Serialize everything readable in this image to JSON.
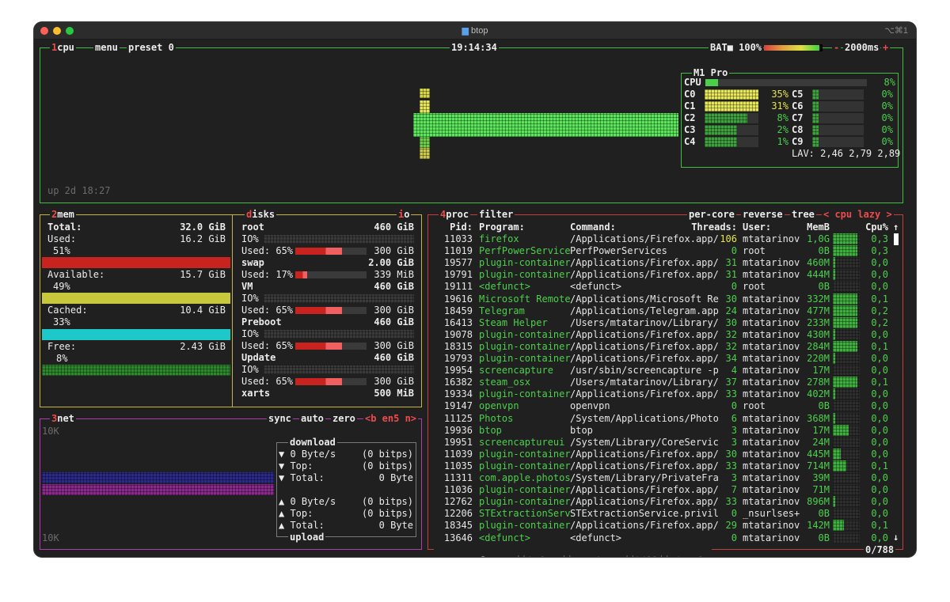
{
  "window": {
    "title": "btop",
    "shortcut": "⌥⌘1"
  },
  "cpu": {
    "label_num": "1",
    "label": "cpu",
    "menu_label": "menu",
    "preset_label": "preset 0",
    "clock": "19:14:34",
    "battery": "BAT■ 100%",
    "battery_percent": 100,
    "interval": "2000ms",
    "minus": "-",
    "plus": "+",
    "uptime": "up 2d 18:27",
    "model": "M1 Pro",
    "total_label": "CPU",
    "total_pct": "8%",
    "total_frac": 0.08,
    "cores": [
      {
        "name": "C0",
        "pct": "35%",
        "frac": 0.35,
        "hot": true
      },
      {
        "name": "C1",
        "pct": "31%",
        "frac": 0.31,
        "hot": true
      },
      {
        "name": "C2",
        "pct": "8%",
        "frac": 0.08,
        "hot": false
      },
      {
        "name": "C3",
        "pct": "2%",
        "frac": 0.02,
        "hot": false
      },
      {
        "name": "C4",
        "pct": "1%",
        "frac": 0.01,
        "hot": false
      },
      {
        "name": "C5",
        "pct": "0%",
        "frac": 0.0,
        "hot": false
      },
      {
        "name": "C6",
        "pct": "0%",
        "frac": 0.0,
        "hot": false
      },
      {
        "name": "C7",
        "pct": "0%",
        "frac": 0.0,
        "hot": false
      },
      {
        "name": "C8",
        "pct": "0%",
        "frac": 0.0,
        "hot": false
      },
      {
        "name": "C9",
        "pct": "0%",
        "frac": 0.0,
        "hot": false
      }
    ],
    "lav": "LAV: 2,46 2,79 2,89"
  },
  "mem": {
    "label_num": "2",
    "label": "mem",
    "total_label": "Total:",
    "total": "32.0 GiB",
    "used_label": "Used:",
    "used": "16.2 GiB",
    "used_pct": "51%",
    "used_frac": 0.51,
    "avail_label": "Available:",
    "avail": "15.7 GiB",
    "avail_pct": "49%",
    "avail_frac": 0.49,
    "cached_label": "Cached:",
    "cached": "10.4 GiB",
    "cached_pct": "33%",
    "cached_frac": 0.33,
    "free_label": "Free:",
    "free": "2.43 GiB",
    "free_pct": "8%",
    "free_frac": 0.08
  },
  "disks": {
    "label_first": "d",
    "label": "isks",
    "io_label_first": "i",
    "io_label": "o",
    "items": [
      {
        "name": "root",
        "size": "460 GiB",
        "io": "IO%",
        "used": "Used: 65%",
        "used_frac": 0.65,
        "used_size": "300 GiB"
      },
      {
        "name": "swap",
        "size": "2.00 GiB",
        "io": "",
        "used": "Used: 17%",
        "used_frac": 0.17,
        "used_size": "339 MiB"
      },
      {
        "name": "VM",
        "size": "460 GiB",
        "io": "IO%",
        "used": "Used: 65%",
        "used_frac": 0.65,
        "used_size": "300 GiB"
      },
      {
        "name": "Preboot",
        "size": "460 GiB",
        "io": "IO%",
        "used": "Used: 65%",
        "used_frac": 0.65,
        "used_size": "300 GiB"
      },
      {
        "name": "Update",
        "size": "460 GiB",
        "io": "IO%",
        "used": "Used: 65%",
        "used_frac": 0.65,
        "used_size": "300 GiB"
      },
      {
        "name": "xarts",
        "size": "500 MiB",
        "io": "",
        "used": "",
        "used_frac": 0,
        "used_size": ""
      }
    ]
  },
  "net": {
    "label_num": "3",
    "label": "net",
    "sync": "sync",
    "auto": "auto",
    "zero": "zero",
    "iface": "<b en5 n>",
    "scale_top": "10K",
    "scale_bottom": "10K",
    "download_label": "download",
    "dl_rate": "▼ 0 Byte/s",
    "dl_rate_bits": "(0 bitps)",
    "dl_top": "▼ Top:",
    "dl_top_bits": "(0 bitps)",
    "dl_total": "▼ Total:",
    "dl_total_val": "0 Byte",
    "ul_rate": "▲ 0 Byte/s",
    "ul_rate_bits": "(0 bitps)",
    "ul_top": "▲ Top:",
    "ul_top_bits": "(0 bitps)",
    "ul_total": "▲ Total:",
    "ul_total_val": "0 Byte",
    "upload_label": "upload"
  },
  "proc": {
    "label_num": "4",
    "label": "proc",
    "filter": "filter",
    "per_core": "per-core",
    "reverse": "reverse",
    "tree": "tree",
    "sort": "< cpu lazy >",
    "headers": {
      "pid": "Pid:",
      "program": "Program:",
      "command": "Command:",
      "threads": "Threads:",
      "user": "User:",
      "mem": "MemB",
      "cpu": "Cpu%"
    },
    "rows": [
      {
        "pid": "11033",
        "program": "firefox",
        "command": "/Applications/Firefox.app/",
        "threads": "106",
        "user": "mtatarinov",
        "mem": "1,0G",
        "cpu": "0,3",
        "graph": 0.9
      },
      {
        "pid": "11019",
        "program": "PerfPowerService",
        "command": "PerfPowerServices",
        "threads": "0",
        "user": "root",
        "mem": "0B",
        "cpu": "0,3",
        "graph": 0.9
      },
      {
        "pid": "19577",
        "program": "plugin-container",
        "command": "/Applications/Firefox.app/",
        "threads": "31",
        "user": "mtatarinov",
        "mem": "460M",
        "cpu": "0,0",
        "graph": 0.1
      },
      {
        "pid": "19791",
        "program": "plugin-container",
        "command": "/Applications/Firefox.app/",
        "threads": "31",
        "user": "mtatarinov",
        "mem": "444M",
        "cpu": "0,0",
        "graph": 0.1
      },
      {
        "pid": "19111",
        "program": "<defunct>",
        "command": "<defunct>",
        "threads": "0",
        "user": "root",
        "mem": "0B",
        "cpu": "0,0",
        "graph": 0.0
      },
      {
        "pid": "19616",
        "program": "Microsoft Remote",
        "command": "/Applications/Microsoft Re",
        "threads": "30",
        "user": "mtatarinov",
        "mem": "332M",
        "cpu": "0,1",
        "graph": 0.9
      },
      {
        "pid": "18459",
        "program": "Telegram",
        "command": "/Applications/Telegram.app",
        "threads": "24",
        "user": "mtatarinov",
        "mem": "477M",
        "cpu": "0,2",
        "graph": 0.9
      },
      {
        "pid": "16413",
        "program": "Steam Helper",
        "command": "/Users/mtatarinov/Library/",
        "threads": "30",
        "user": "mtatarinov",
        "mem": "233M",
        "cpu": "0,2",
        "graph": 0.9
      },
      {
        "pid": "19078",
        "program": "plugin-container",
        "command": "/Applications/Firefox.app/",
        "threads": "32",
        "user": "mtatarinov",
        "mem": "430M",
        "cpu": "0,0",
        "graph": 0.1
      },
      {
        "pid": "18315",
        "program": "plugin-container",
        "command": "/Applications/Firefox.app/",
        "threads": "32",
        "user": "mtatarinov",
        "mem": "284M",
        "cpu": "0,1",
        "graph": 0.9
      },
      {
        "pid": "19793",
        "program": "plugin-container",
        "command": "/Applications/Firefox.app/",
        "threads": "34",
        "user": "mtatarinov",
        "mem": "220M",
        "cpu": "0,0",
        "graph": 0.1
      },
      {
        "pid": "19954",
        "program": "screencapture",
        "command": "/usr/sbin/screencapture -p",
        "threads": "4",
        "user": "mtatarinov",
        "mem": "17M",
        "cpu": "0,0",
        "graph": 0.0
      },
      {
        "pid": "16382",
        "program": "steam_osx",
        "command": "/Users/mtatarinov/Library/",
        "threads": "37",
        "user": "mtatarinov",
        "mem": "278M",
        "cpu": "0,1",
        "graph": 0.9
      },
      {
        "pid": "19334",
        "program": "plugin-container",
        "command": "/Applications/Firefox.app/",
        "threads": "33",
        "user": "mtatarinov",
        "mem": "402M",
        "cpu": "0,0",
        "graph": 0.1
      },
      {
        "pid": "19147",
        "program": "openvpn",
        "command": "openvpn",
        "threads": "0",
        "user": "root",
        "mem": "0B",
        "cpu": "0,0",
        "graph": 0.0
      },
      {
        "pid": "11125",
        "program": "Photos",
        "command": "/System/Applications/Photo",
        "threads": "6",
        "user": "mtatarinov",
        "mem": "368M",
        "cpu": "0,0",
        "graph": 0.1
      },
      {
        "pid": "19936",
        "program": "btop",
        "command": "btop",
        "threads": "3",
        "user": "mtatarinov",
        "mem": "17M",
        "cpu": "0,0",
        "graph": 0.6
      },
      {
        "pid": "19951",
        "program": "screencaptureui",
        "command": "/System/Library/CoreServic",
        "threads": "3",
        "user": "mtatarinov",
        "mem": "24M",
        "cpu": "0,0",
        "graph": 0.0
      },
      {
        "pid": "11039",
        "program": "plugin-container",
        "command": "/Applications/Firefox.app/",
        "threads": "30",
        "user": "mtatarinov",
        "mem": "445M",
        "cpu": "0,0",
        "graph": 0.3
      },
      {
        "pid": "11035",
        "program": "plugin-container",
        "command": "/Applications/Firefox.app/",
        "threads": "33",
        "user": "mtatarinov",
        "mem": "714M",
        "cpu": "0,1",
        "graph": 0.5
      },
      {
        "pid": "11311",
        "program": "com.apple.photos",
        "command": "/System/Library/PrivateFra",
        "threads": "3",
        "user": "mtatarinov",
        "mem": "39M",
        "cpu": "0,0",
        "graph": 0.0
      },
      {
        "pid": "11036",
        "program": "plugin-container",
        "command": "/Applications/Firefox.app/",
        "threads": "7",
        "user": "mtatarinov",
        "mem": "71M",
        "cpu": "0,0",
        "graph": 0.0
      },
      {
        "pid": "12762",
        "program": "plugin-container",
        "command": "/Applications/Firefox.app/",
        "threads": "33",
        "user": "mtatarinov",
        "mem": "896M",
        "cpu": "0,0",
        "graph": 0.1
      },
      {
        "pid": "12206",
        "program": "STExtractionServ",
        "command": "STExtractionService.privil",
        "threads": "0",
        "user": "_nsurlses+",
        "mem": "0B",
        "cpu": "0,0",
        "graph": 0.0
      },
      {
        "pid": "18345",
        "program": "plugin-container",
        "command": "/Applications/Firefox.app/",
        "threads": "29",
        "user": "mtatarinov",
        "mem": "142M",
        "cpu": "0,1",
        "graph": 0.4
      },
      {
        "pid": "13646",
        "program": "<defunct>",
        "command": "<defunct>",
        "threads": "0",
        "user": "mtatarinov",
        "mem": "0B",
        "cpu": "0,0",
        "graph": 0.0
      }
    ],
    "footer": {
      "up": "↑",
      "select": "select",
      "down": "↓",
      "info": "info",
      "enter": "↵",
      "terminate": "terminate",
      "kill": "kill",
      "signals": "signals",
      "count": "0/788"
    },
    "scroll_up": "↑",
    "scroll_down": "↓"
  },
  "colors": {
    "cpu_box": "#3fbf3f",
    "mem_box": "#c8b43c",
    "net_box": "#b03cb0",
    "proc_box": "#c83c3c",
    "accent": "#ee4b4b"
  }
}
